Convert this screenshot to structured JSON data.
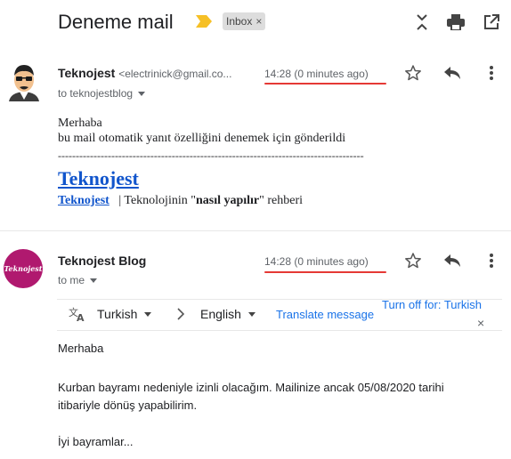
{
  "header": {
    "subject": "Deneme mail",
    "label": "Inbox",
    "label_remove": "×",
    "icons": [
      "expand-collapse-icon",
      "print-icon",
      "open-in-new-window-icon"
    ]
  },
  "message1": {
    "sender_name": "Teknojest",
    "sender_email": "<electrinick@gmail.co...",
    "to": "to teknojestblog",
    "time": "14:28 (0 minutes ago)",
    "body_line1": "Merhaba",
    "body_line2": "bu mail otomatik yanıt özelliğini denemek için gönderildi",
    "separator": "--------------------------------------------------------------------------------------",
    "signature_title": "Teknojest",
    "signature_link": "Teknojest",
    "signature_text_a": "| Teknolojinin \"",
    "signature_text_bold": "nasıl yapılır",
    "signature_text_b": "\" rehberi"
  },
  "message2": {
    "sender_name": "Teknojest Blog",
    "avatar_text": "Teknojest",
    "to": "to me",
    "time": "14:28 (0 minutes ago)",
    "translate": {
      "source_lang": "Turkish",
      "target_lang": "English",
      "translate_link": "Translate message",
      "turn_off_link": "Turn off for: Turkish",
      "close": "×"
    },
    "body_line1": "Merhaba",
    "body_line2": "Kurban bayramı nedeniyle izinli olacağım. Mailinize ancak 05/08/2020 tarihi",
    "body_line3": "itibariyle dönüş yapabilirim.",
    "body_line4": "İyi bayramlar..."
  },
  "colors": {
    "link_blue": "#1155cc",
    "translate_blue": "#1a73e8",
    "highlight_red": "#e53935",
    "important_yellow": "#f6c026",
    "avatar_magenta": "#b0196f"
  }
}
